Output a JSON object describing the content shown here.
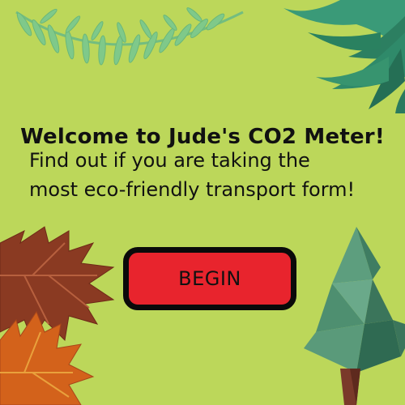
{
  "screen": {
    "title": "Welcome to Jude's CO2 Meter!",
    "subtitle_line1": "Find out if you are taking the",
    "subtitle_line2": "most eco-friendly transport form!",
    "begin_label": "BEGIN"
  },
  "decorations": [
    "fern-leaf-icon",
    "palm-leaves-icon",
    "maple-leaf-brown-icon",
    "maple-leaf-orange-icon",
    "low-poly-tree-icon"
  ],
  "colors": {
    "background": "#bcd75a",
    "button_fill": "#e8242d",
    "button_border": "#0a0a0a",
    "text": "#111111"
  }
}
